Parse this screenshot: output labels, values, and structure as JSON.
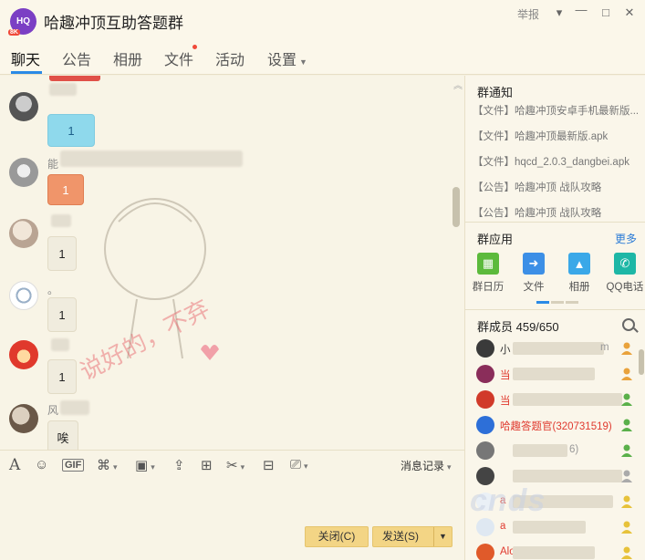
{
  "window": {
    "group_avatar_text": "HQ",
    "group_avatar_tag": "8K",
    "title": "哈趣冲顶互助答题群",
    "report": "举报"
  },
  "tabs": [
    {
      "label": "聊天",
      "active": true
    },
    {
      "label": "公告"
    },
    {
      "label": "相册"
    },
    {
      "label": "文件",
      "has_dot": true
    },
    {
      "label": "活动"
    },
    {
      "label": "设置",
      "has_caret": true
    }
  ],
  "chat": {
    "messages": [
      {
        "sender": "",
        "text": "1"
      },
      {
        "sender": "能",
        "text": "1"
      },
      {
        "sender": "",
        "text": "1"
      },
      {
        "sender": "。",
        "text": "1"
      },
      {
        "sender": "",
        "text": "1"
      },
      {
        "sender": "风",
        "text": "唉"
      }
    ],
    "watermark_text": "说好的，不弃"
  },
  "toolbar": {
    "history_label": "消息记录",
    "gif_label": "GIF"
  },
  "buttons": {
    "close": "关闭(C)",
    "send": "发送(S)"
  },
  "right_panel": {
    "notice_title": "群通知",
    "notices": [
      "【文件】哈趣冲顶安卓手机最新版...",
      "【文件】哈趣冲顶最新版.apk",
      "【文件】hqcd_2.0.3_dangbei.apk",
      "【公告】哈趣冲顶 战队攻略",
      "【公告】哈趣冲顶 战队攻略"
    ],
    "apps_title": "群应用",
    "more": "更多",
    "apps": [
      {
        "label": "群日历",
        "icon": "calendar-icon",
        "color": "#5cba3c"
      },
      {
        "label": "文件",
        "icon": "file-icon",
        "color": "#3c8fe6"
      },
      {
        "label": "相册",
        "icon": "photo-icon",
        "color": "#3aa8e8"
      },
      {
        "label": "QQ电话",
        "icon": "phone-icon",
        "color": "#1db7a6"
      }
    ],
    "members_title": "群成员 459/650",
    "members": [
      {
        "name": "小",
        "suffix": "m",
        "color": "#333"
      },
      {
        "name": "当",
        "suffix": "",
        "color": "#e03a2f"
      },
      {
        "name": "当",
        "suffix": "",
        "color": "#e03a2f"
      },
      {
        "name": "哈趣答题官(320731519)",
        "suffix": "",
        "color": "#e03a2f"
      },
      {
        "name": "",
        "suffix": "6)",
        "color": "#333"
      },
      {
        "name": "",
        "suffix": "",
        "color": "#333"
      },
      {
        "name": "a",
        "suffix": "",
        "color": "#e03a2f"
      },
      {
        "name": "a",
        "suffix": "",
        "color": "#e03a2f"
      },
      {
        "name": "Alon",
        "suffix": "",
        "color": "#e03a2f"
      }
    ]
  }
}
